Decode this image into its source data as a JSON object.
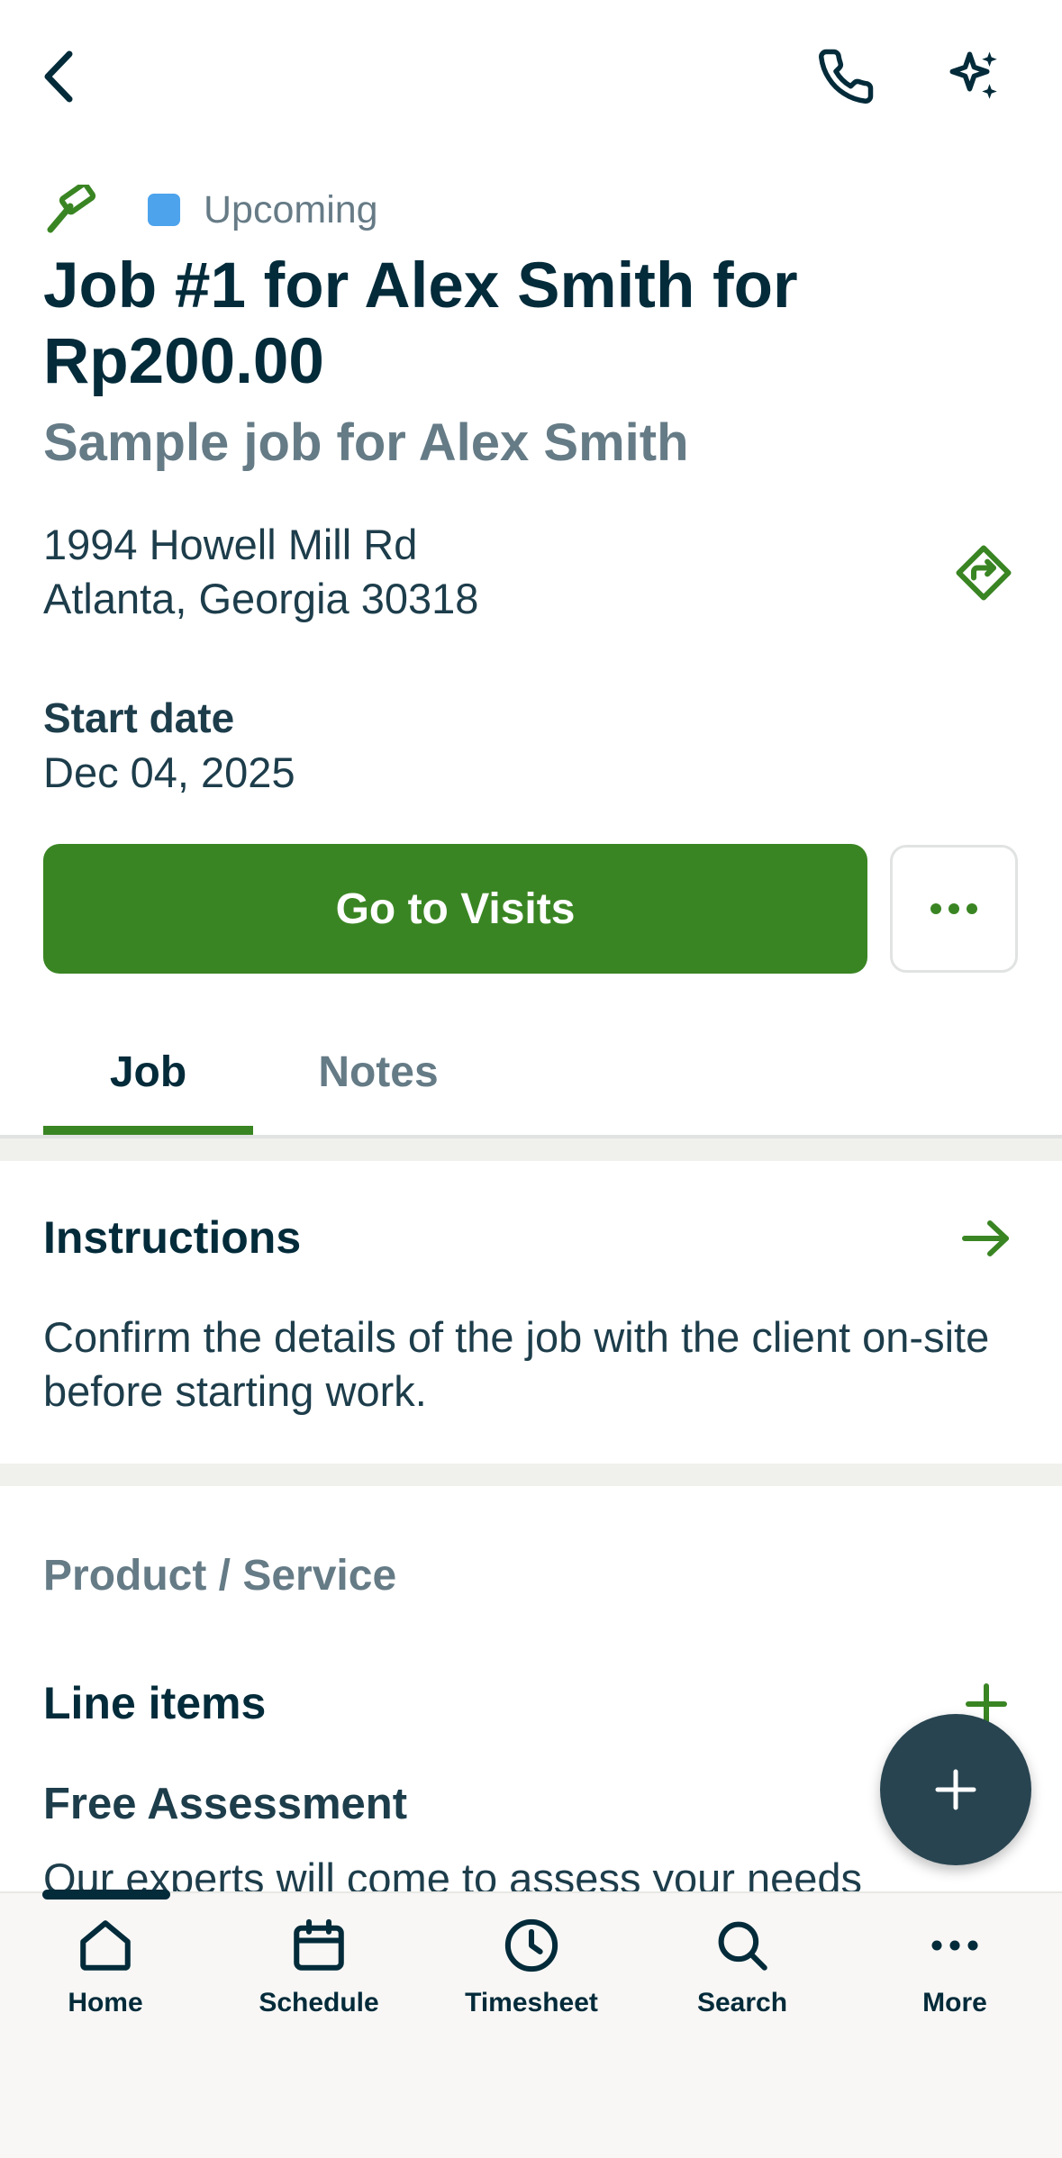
{
  "header": {
    "back_icon": "chevron-left-icon",
    "call_icon": "phone-icon",
    "ai_icon": "sparkles-icon"
  },
  "status": {
    "icon": "hammer-icon",
    "label": "Upcoming",
    "color": "#4da3ec"
  },
  "job": {
    "title": "Job #1 for Alex Smith for Rp200.00",
    "subtitle": "Sample job for Alex Smith",
    "address_line1": "1994 Howell Mill Rd",
    "address_line2": "Atlanta, Georgia 30318",
    "start_date_label": "Start date",
    "start_date_value": "Dec 04, 2025"
  },
  "actions": {
    "primary_label": "Go to Visits",
    "more_icon": "ellipsis-icon"
  },
  "tabs": [
    {
      "label": "Job",
      "active": true
    },
    {
      "label": "Notes",
      "active": false
    }
  ],
  "instructions": {
    "title": "Instructions",
    "body": "Confirm the details of the job with the client on-site before starting work."
  },
  "product_service": {
    "section_title": "Product / Service",
    "line_items_title": "Line items",
    "items": [
      {
        "name": "Free Assessment",
        "description": "Our experts will come to assess your needs"
      }
    ]
  },
  "bottom_nav": [
    {
      "label": "Home",
      "icon": "home-icon"
    },
    {
      "label": "Schedule",
      "icon": "calendar-icon"
    },
    {
      "label": "Timesheet",
      "icon": "clock-icon"
    },
    {
      "label": "Search",
      "icon": "search-icon"
    },
    {
      "label": "More",
      "icon": "ellipsis-icon"
    }
  ],
  "colors": {
    "brand_green": "#3a8523",
    "navy": "#032b3a",
    "fab": "#284451"
  }
}
